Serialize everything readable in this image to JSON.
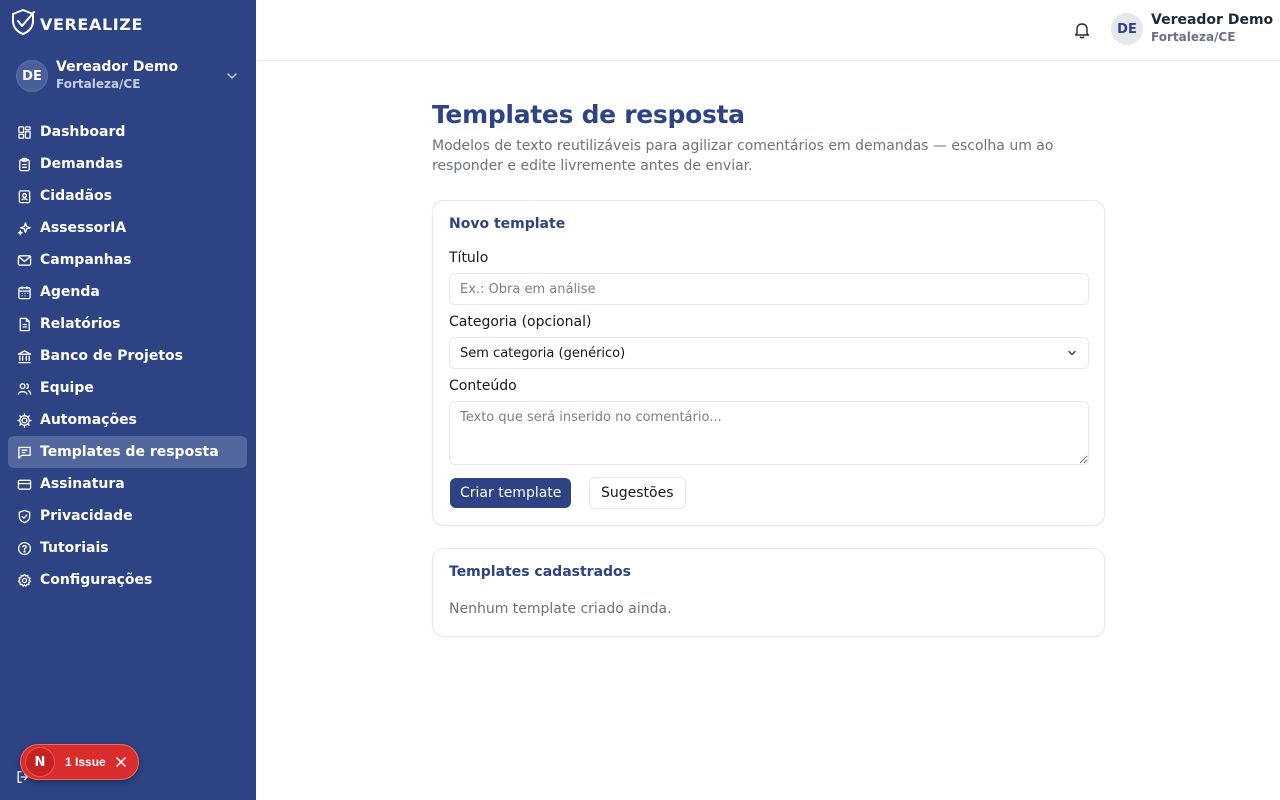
{
  "brand": {
    "name": "VEREALIZE",
    "logo_icon": "shield-check-icon"
  },
  "account": {
    "initials": "DE",
    "name": "Vereador Demo",
    "city": "Fortaleza/CE"
  },
  "nav": {
    "items": [
      {
        "label": "Dashboard",
        "icon": "dashboard-icon",
        "active": false
      },
      {
        "label": "Demandas",
        "icon": "clipboard-icon",
        "active": false
      },
      {
        "label": "Cidadãos",
        "icon": "contact-icon",
        "active": false
      },
      {
        "label": "AssessorIA",
        "icon": "sparkles-icon",
        "active": false
      },
      {
        "label": "Campanhas",
        "icon": "mail-icon",
        "active": false
      },
      {
        "label": "Agenda",
        "icon": "calendar-icon",
        "active": false
      },
      {
        "label": "Relatórios",
        "icon": "file-text-icon",
        "active": false
      },
      {
        "label": "Banco de Projetos",
        "icon": "landmark-icon",
        "active": false
      },
      {
        "label": "Equipe",
        "icon": "users-icon",
        "active": false
      },
      {
        "label": "Automações",
        "icon": "cog-icon",
        "active": false
      },
      {
        "label": "Templates de resposta",
        "icon": "message-square-text-icon",
        "active": true
      },
      {
        "label": "Assinatura",
        "icon": "credit-card-icon",
        "active": false
      },
      {
        "label": "Privacidade",
        "icon": "shield-check-icon",
        "active": false
      },
      {
        "label": "Tutoriais",
        "icon": "help-circle-icon",
        "active": false
      },
      {
        "label": "Configurações",
        "icon": "settings-icon",
        "active": false
      }
    ]
  },
  "topbar": {
    "initials": "DE",
    "name": "Vereador Demo",
    "city": "Fortaleza/CE"
  },
  "page": {
    "title": "Templates de resposta",
    "description": "Modelos de texto reutilizáveis para agilizar comentários em demandas — escolha um ao responder e edite livremente antes de enviar."
  },
  "form": {
    "title": "Novo template",
    "title_label": "Título",
    "title_placeholder": "Ex.: Obra em análise",
    "category_label": "Categoria (opcional)",
    "category_value": "Sem categoria (genérico)",
    "content_label": "Conteúdo",
    "content_placeholder": "Texto que será inserido no comentário...",
    "create_label": "Criar template",
    "suggestions_label": "Sugestões"
  },
  "list": {
    "title": "Templates cadastrados",
    "empty": "Nenhum template criado ainda."
  },
  "dev_badge": {
    "letter": "N",
    "text": "1 Issue"
  },
  "colors": {
    "sidebar": "#2d4383",
    "accent": "#2d4383",
    "active_item": "#53679f",
    "issue": "#d92c2c"
  }
}
